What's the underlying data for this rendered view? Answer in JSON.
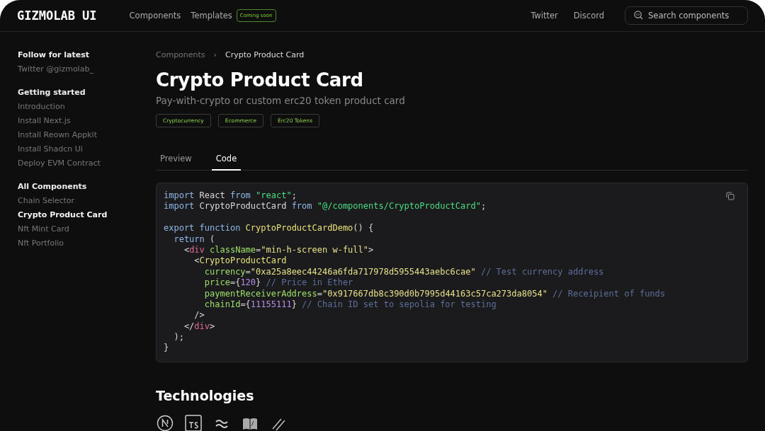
{
  "header": {
    "logo": "GIZMOLAB UI",
    "nav": [
      {
        "label": "Components"
      },
      {
        "label": "Templates",
        "badge": "Coming soon"
      }
    ],
    "links": [
      "Twitter",
      "Discord"
    ],
    "search": {
      "placeholder": "Search components"
    }
  },
  "sidebar": {
    "sections": [
      {
        "heading": "Follow for latest",
        "items": [
          {
            "label": "Twitter @gizmolab_",
            "selected": false
          }
        ]
      },
      {
        "heading": "Getting started",
        "items": [
          {
            "label": "Introduction",
            "selected": false
          },
          {
            "label": "Install Next.js",
            "selected": false
          },
          {
            "label": "Install Reown Appkit",
            "selected": false
          },
          {
            "label": "Install Shadcn Ui",
            "selected": false
          },
          {
            "label": "Deploy EVM Contract",
            "selected": false
          }
        ]
      },
      {
        "heading": "All Components",
        "items": [
          {
            "label": "Chain Selector",
            "selected": false
          },
          {
            "label": "Crypto Product Card",
            "selected": true
          },
          {
            "label": "Nft Mint Card",
            "selected": false
          },
          {
            "label": "Nft Portfolio",
            "selected": false
          }
        ]
      }
    ]
  },
  "breadcrumb": [
    "Components",
    "›",
    "Crypto Product Card"
  ],
  "title": "Crypto Product Card",
  "subtitle": "Pay-with-crypto or custom erc20 token product card",
  "tags": [
    "Cryptocurrency",
    "Ecommerce",
    "Erc20 Tokens"
  ],
  "tabs": [
    {
      "label": "Preview",
      "selected": false
    },
    {
      "label": "Code",
      "selected": true
    }
  ],
  "code": [
    {
      "kind": "line",
      "tokens": [
        {
          "t": "import",
          "kind": "kw"
        },
        {
          "t": " React ",
          "kind": "p"
        },
        {
          "t": "from",
          "kind": "kw"
        },
        {
          "t": " \"react\"",
          "kind": "str"
        },
        {
          "t": ";",
          "kind": "p"
        }
      ]
    },
    {
      "kind": "line",
      "tokens": [
        {
          "t": "import",
          "kind": "kw"
        },
        {
          "t": " CryptoProductCard ",
          "kind": "p"
        },
        {
          "t": "from",
          "kind": "kw"
        },
        {
          "t": " \"@/components/CryptoProductCard\"",
          "kind": "str"
        },
        {
          "t": ";",
          "kind": "p"
        }
      ]
    },
    {
      "kind": "blank"
    },
    {
      "kind": "line",
      "tokens": [
        {
          "t": "export",
          "kind": "kw"
        },
        {
          "t": " function",
          "kind": "kw"
        },
        {
          "t": " CryptoProductCardDemo",
          "kind": "fn"
        },
        {
          "t": "() {",
          "kind": "p"
        }
      ]
    },
    {
      "kind": "line",
      "tokens": [
        {
          "t": "  return",
          "kind": "kw"
        },
        {
          "t": " (",
          "kind": "p"
        }
      ]
    },
    {
      "kind": "line",
      "tokens": [
        {
          "t": "    <",
          "kind": "p"
        },
        {
          "t": "div",
          "kind": "tag"
        },
        {
          "t": " className",
          "kind": "attr"
        },
        {
          "t": "=",
          "kind": "p"
        },
        {
          "t": "\"min-h-screen w-full\"",
          "kind": "val"
        },
        {
          "t": ">",
          "kind": "p"
        }
      ]
    },
    {
      "kind": "line",
      "tokens": [
        {
          "t": "      <",
          "kind": "p"
        },
        {
          "t": "CryptoProductCard",
          "kind": "fn"
        }
      ]
    },
    {
      "kind": "line",
      "tokens": [
        {
          "t": "        currency",
          "kind": "attr"
        },
        {
          "t": "=",
          "kind": "p"
        },
        {
          "t": "\"0xa25a8eec44246a6fda717978d5955443aebc6cae\"",
          "kind": "val"
        },
        {
          "t": " // Test currency address",
          "kind": "cm"
        }
      ]
    },
    {
      "kind": "line",
      "tokens": [
        {
          "t": "        price",
          "kind": "attr"
        },
        {
          "t": "={",
          "kind": "p"
        },
        {
          "t": "120",
          "kind": "num"
        },
        {
          "t": "} ",
          "kind": "p"
        },
        {
          "t": "// Price in Ether",
          "kind": "cm"
        }
      ]
    },
    {
      "kind": "line",
      "tokens": [
        {
          "t": "        paymentReceiverAddress",
          "kind": "attr"
        },
        {
          "t": "=",
          "kind": "p"
        },
        {
          "t": "\"0x917667db8c390d0b7995d44163c57ca273da8054\"",
          "kind": "val"
        },
        {
          "t": " // Receipient of funds",
          "kind": "cm"
        }
      ]
    },
    {
      "kind": "line",
      "tokens": [
        {
          "t": "        chainId",
          "kind": "attr"
        },
        {
          "t": "={",
          "kind": "p"
        },
        {
          "t": "11155111",
          "kind": "num"
        },
        {
          "t": "} ",
          "kind": "p"
        },
        {
          "t": "// Chain ID set to sepolia for testing",
          "kind": "cm"
        }
      ]
    },
    {
      "kind": "line",
      "tokens": [
        {
          "t": "      />",
          "kind": "p"
        }
      ]
    },
    {
      "kind": "line",
      "tokens": [
        {
          "t": "    </",
          "kind": "p"
        },
        {
          "t": "div",
          "kind": "tag"
        },
        {
          "t": ">",
          "kind": "p"
        }
      ]
    },
    {
      "kind": "line",
      "tokens": [
        {
          "t": "  );",
          "kind": "p"
        }
      ]
    },
    {
      "kind": "line",
      "tokens": [
        {
          "t": "}",
          "kind": "p"
        }
      ]
    }
  ],
  "technologies": {
    "heading": "Technologies"
  }
}
